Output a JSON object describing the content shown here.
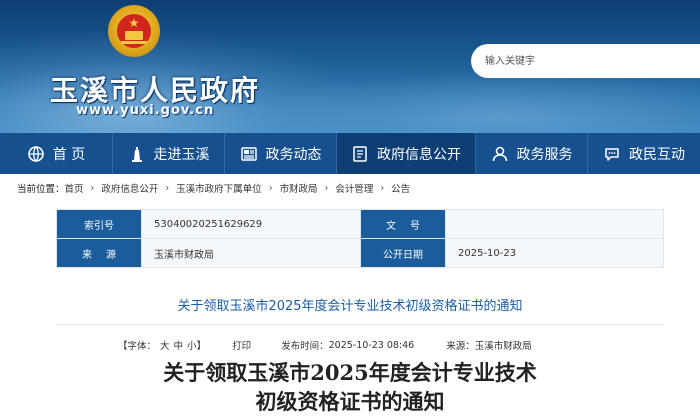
{
  "header": {
    "site_title": "玉溪市人民政府",
    "site_url": "www.yuxi.gov.cn",
    "search_placeholder": "输入关键字"
  },
  "nav": {
    "items": [
      {
        "label": "首 页",
        "icon": "globe-icon"
      },
      {
        "label": "走进玉溪",
        "icon": "tower-icon"
      },
      {
        "label": "政务动态",
        "icon": "newspaper-icon"
      },
      {
        "label": "政府信息公开",
        "icon": "document-icon",
        "active": true
      },
      {
        "label": "政务服务",
        "icon": "user-icon"
      },
      {
        "label": "政民互动",
        "icon": "chat-icon"
      }
    ]
  },
  "breadcrumb": {
    "label": "当前位置：",
    "items": [
      "首页",
      "政府信息公开",
      "玉溪市政府下属单位",
      "市财政局",
      "会计管理",
      "公告"
    ],
    "separator": "›"
  },
  "info": {
    "index_label": "索引号",
    "index_value": "53040020251629629",
    "doc_no_label": "文号",
    "doc_no_value": "",
    "source_label": "来源",
    "source_value": "玉溪市财政局",
    "publish_date_label": "公开日期",
    "publish_date_value": "2025-10-23"
  },
  "article": {
    "subtitle": "关于领取玉溪市2025年度会计专业技术初级资格证书的通知",
    "font_label": "【字体：",
    "font_sizes": [
      "大",
      "中",
      "小"
    ],
    "font_close": "】",
    "print_label": "打印",
    "publish_time_label": "发布时间：",
    "publish_time_value": "2025-10-23 08:46",
    "source_label": "来源：",
    "source_value": "玉溪市财政局",
    "title_line1": "关于领取玉溪市2025年度会计专业技术",
    "title_line2": "初级资格证书的通知"
  },
  "colors": {
    "nav_bg": "#16508e",
    "nav_active": "#0d3e74",
    "table_label_bg": "#1b5c9b",
    "subtitle_color": "#1a5fa5"
  }
}
